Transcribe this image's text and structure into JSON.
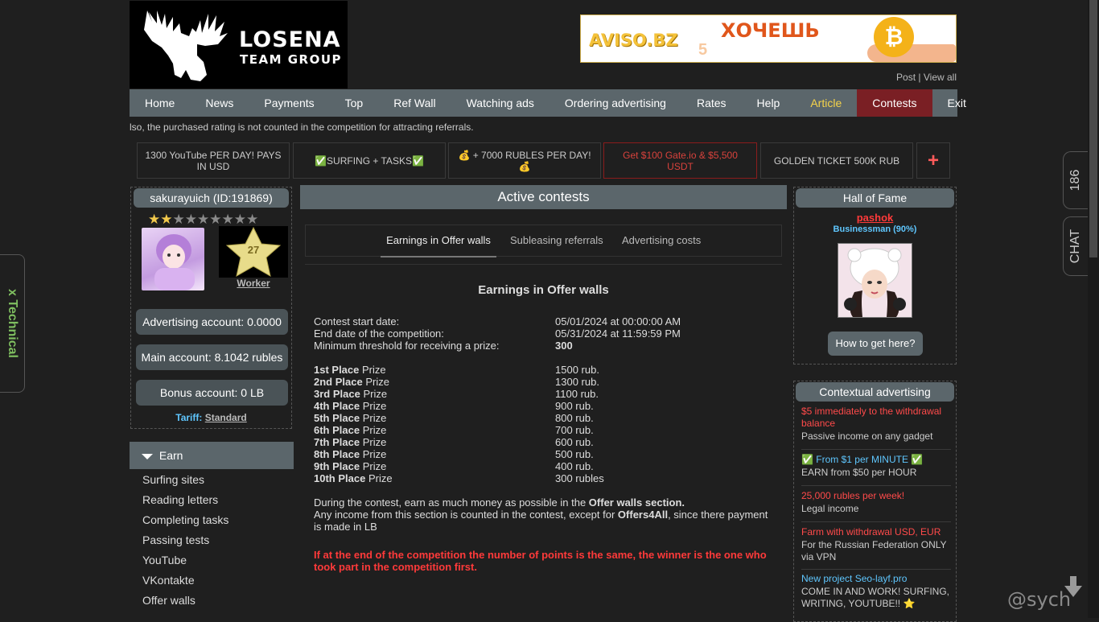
{
  "header": {
    "logo_line1": "LOSENA",
    "logo_line2": "TEAM GROUP",
    "banner": {
      "brand": "AVISO.BZ",
      "num": "5",
      "headline": "ХОЧЕШЬ"
    },
    "post_label": "Post",
    "post_sep": "|",
    "view_all_label": "View all"
  },
  "nav": [
    "Home",
    "News",
    "Payments",
    "Top",
    "Ref Wall",
    "Watching ads",
    "Ordering advertising",
    "Rates",
    "Help",
    "Article",
    "Contests",
    "Exit"
  ],
  "ticker": "lso, the purchased rating is not counted in the competition for attracting referrals.",
  "promos": [
    "1300 YouTube PER DAY! PAYS IN USD",
    "✅SURFING + TASKS✅",
    "💰 + 7000 RUBLES PER DAY! 💰",
    "Get $100 Gate.io & $5,500 USDT",
    "GOLDEN TICKET 500K RUB",
    "+"
  ],
  "user": {
    "name": "sakurayuich (ID:191869)",
    "stars_filled": 2,
    "stars_total": 9,
    "level": "27",
    "rank": "Worker",
    "advertising_account": "Advertising account: 0.0000",
    "main_account": "Main account: 8.1042 rubles",
    "bonus_account": "Bonus account: 0 LB",
    "tariff_label": "Tariff:",
    "tariff_value": "Standard"
  },
  "sidebar": {
    "section": "Earn",
    "items": [
      "Surfing sites",
      "Reading letters",
      "Completing tasks",
      "Passing tests",
      "YouTube",
      "VKontakte",
      "Offer walls"
    ]
  },
  "main": {
    "header": "Active contests",
    "tabs": [
      "Earnings in Offer walls",
      "Subleasing referrals",
      "Advertising costs"
    ],
    "contest_title": "Earnings in Offer walls",
    "info": [
      {
        "label": "Contest start date:",
        "value": "05/01/2024 at 00:00:00 AM"
      },
      {
        "label": "End date of the competition:",
        "value": "05/31/2024 at 11:59:59 PM"
      },
      {
        "label": "Minimum threshold for receiving a prize:",
        "value": "300"
      }
    ],
    "prizes": [
      {
        "place": "1st Place",
        "suffix": " Prize",
        "value": "1500 rub."
      },
      {
        "place": "2nd Place",
        "suffix": " Prize",
        "value": "1300 rub."
      },
      {
        "place": "3rd Place",
        "suffix": " Prize",
        "value": "1100 rub."
      },
      {
        "place": "4th Place",
        "suffix": " Prize",
        "value": "900 rub."
      },
      {
        "place": "5th Place",
        "suffix": " Prize",
        "value": "800 rub."
      },
      {
        "place": "6th Place",
        "suffix": " Prize",
        "value": "700 rub."
      },
      {
        "place": "7th Place",
        "suffix": " Prize",
        "value": "600 rub."
      },
      {
        "place": "8th Place",
        "suffix": " Prize",
        "value": "500 rub."
      },
      {
        "place": "9th Place",
        "suffix": " Prize",
        "value": "400 rub."
      },
      {
        "place": "10th Place",
        "suffix": " Prize",
        "value": "300 rubles"
      }
    ],
    "desc1_a": "During the contest, earn as much money as possible in the ",
    "desc1_b": "Offer walls section.",
    "desc2_a": "Any income from this section is counted in the contest, except for ",
    "desc2_b": "Offers4All",
    "desc2_c": ", since there payment is made in LB",
    "warning": "If at the end of the competition the number of points is the same, the winner is the one who took part in the competition first."
  },
  "hall_of_fame": {
    "title": "Hall of Fame",
    "name": "pashok",
    "status": "Businessman (90%)",
    "button": "How to get here?"
  },
  "contextual": {
    "title": "Contextual advertising",
    "items": [
      {
        "title": "$5 immediately to the withdrawal balance",
        "desc": "Passive income on any gadget"
      },
      {
        "title": "✅ From $1 per MINUTE ✅",
        "desc": "EARN from $50 per HOUR"
      },
      {
        "title": "25,000 rubles per week!",
        "desc": "Legal income"
      },
      {
        "title": "Farm with withdrawal USD, EUR",
        "desc": "For the Russian Federation ONLY via VPN"
      },
      {
        "title": "New project Seo-layf.pro",
        "desc": "COME IN AND WORK! SURFING, WRITING, YOUTUBE!! ⭐"
      }
    ]
  },
  "side_tabs": {
    "count": "186",
    "chat": "CHAT",
    "technical": "x Technical"
  },
  "watermark": "@sych",
  "colors": {
    "nav_bg": "#5b666b",
    "active_nav": "#7a1f24",
    "article": "#f5d34a",
    "warning": "#ff3a3a",
    "link_blue": "#5fc7ff"
  }
}
